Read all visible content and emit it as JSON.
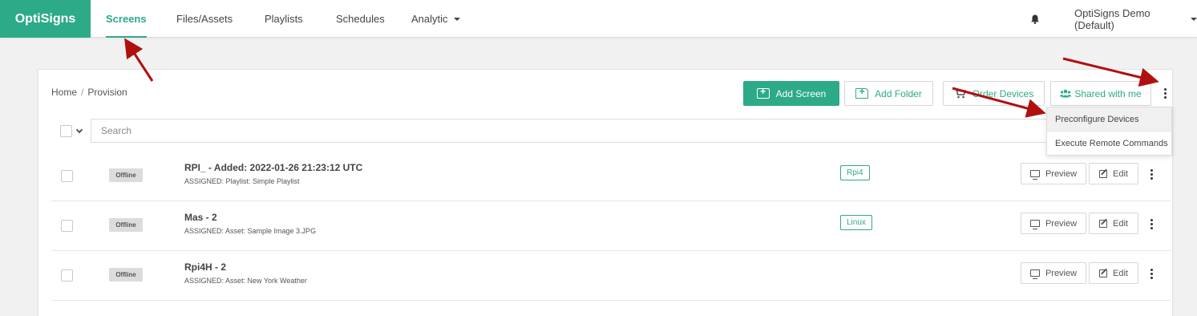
{
  "nav": {
    "brand": "OptiSigns",
    "items": [
      {
        "label": "Screens",
        "active": true
      },
      {
        "label": "Files/Assets"
      },
      {
        "label": "Playlists"
      },
      {
        "label": "Schedules"
      },
      {
        "label": "Analytic"
      }
    ],
    "account": "OptiSigns Demo (Default)",
    "bell_icon": "bell-icon"
  },
  "breadcrumb": {
    "home": "Home",
    "separator": "/",
    "current": "Provision"
  },
  "toolbar": {
    "add_screen": "Add Screen",
    "add_folder": "Add Folder",
    "order_devices": "Order Devices",
    "shared_with_me": "Shared with me"
  },
  "menu": {
    "items": [
      "Preconfigure Devices",
      "Execute Remote Commands"
    ],
    "highlighted": "Preconfigure Devices"
  },
  "search": {
    "placeholder": "Search"
  },
  "rows": [
    {
      "status": "Offline",
      "title": "RPI_ - Added: 2022-01-26 21:23:12 UTC",
      "subtitle": "ASSIGNED: Playlist: Simple Playlist",
      "tag": "Rpi4",
      "preview": "Preview",
      "edit": "Edit"
    },
    {
      "status": "Offline",
      "title": "Mas - 2",
      "subtitle": "ASSIGNED: Asset: Sample Image 3.JPG",
      "tag": "Linux",
      "preview": "Preview",
      "edit": "Edit"
    },
    {
      "status": "Offline",
      "title": "Rpi4H - 2",
      "subtitle": "ASSIGNED: Asset: New York Weather",
      "tag": "",
      "preview": "Preview",
      "edit": "Edit"
    }
  ],
  "colors": {
    "accent": "#2daa88",
    "arrow": "#b01010",
    "badge_bg": "#dcdcdc"
  }
}
